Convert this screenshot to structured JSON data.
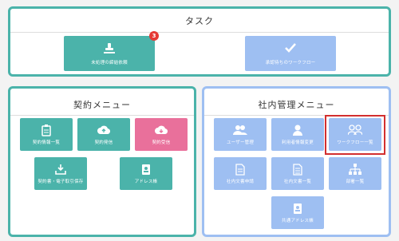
{
  "task_panel": {
    "title": "タスク",
    "pending_approval": {
      "label": "未処理の締結依頼",
      "badge": "3"
    },
    "awaiting_workflow": {
      "label": "承認待ちのワークフロー"
    }
  },
  "contract_menu": {
    "title": "契約メニュー",
    "items": [
      {
        "label": "契約情報一覧",
        "icon": "clipboard-icon"
      },
      {
        "label": "契約発信",
        "icon": "cloud-upload-icon"
      },
      {
        "label": "契約受信",
        "icon": "cloud-download-icon"
      },
      {
        "label": "契約書・電子取引保存",
        "icon": "download-tray-icon"
      },
      {
        "label": "アドレス帳",
        "icon": "address-book-icon"
      }
    ]
  },
  "internal_menu": {
    "title": "社内管理メニュー",
    "items": [
      {
        "label": "ユーザー管理",
        "icon": "users-icon"
      },
      {
        "label": "利用者情報変更",
        "icon": "user-icon"
      },
      {
        "label": "ワークフロー一覧",
        "icon": "workflow-users-icon"
      },
      {
        "label": "社内文書申請",
        "icon": "document-icon"
      },
      {
        "label": "社内文書一覧",
        "icon": "document-list-icon"
      },
      {
        "label": "部署一覧",
        "icon": "org-chart-icon"
      },
      {
        "label": "共通アドレス帳",
        "icon": "address-book-icon"
      }
    ]
  },
  "colors": {
    "teal": "#4bb3aa",
    "pink": "#e9709b",
    "blue": "#9ebff2",
    "badge": "#e53935",
    "highlight": "#d32f2f"
  }
}
